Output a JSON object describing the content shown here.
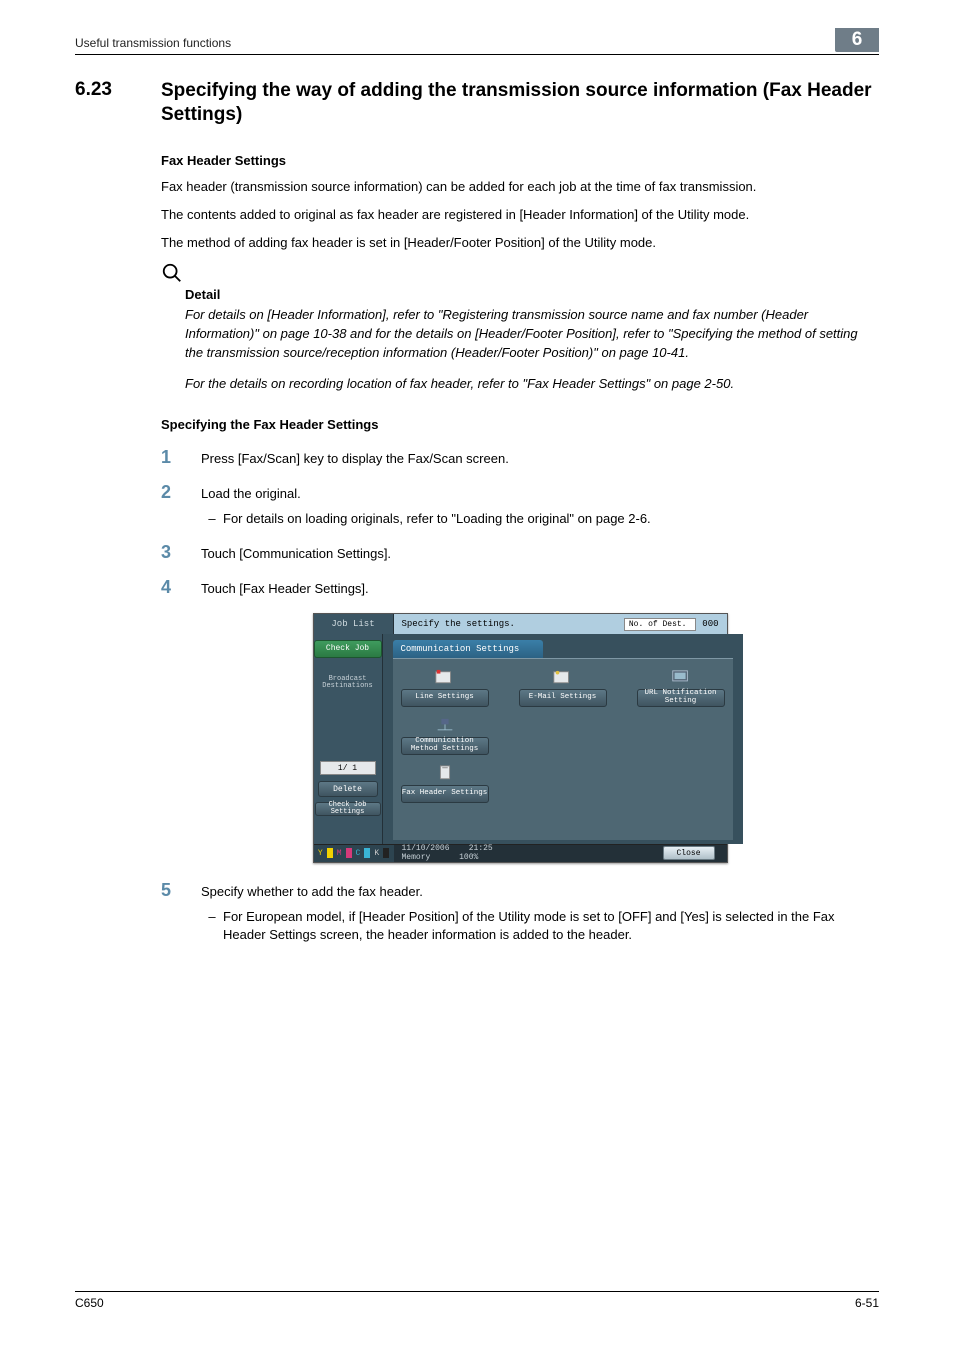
{
  "header": {
    "breadcrumb": "Useful transmission functions",
    "chapter_badge": "6"
  },
  "section": {
    "number": "6.23",
    "title": "Specifying the way of adding the transmission source information (Fax Header Settings)"
  },
  "sub1": {
    "heading": "Fax Header Settings",
    "p1": "Fax header (transmission source information) can be added for each job at the time of fax transmission.",
    "p2": "The contents added to original as fax header are registered in [Header Information] of the Utility mode.",
    "p3": "The method of adding fax header is set in [Header/Footer Position] of the Utility mode."
  },
  "detail": {
    "label": "Detail",
    "p1": "For details on [Header Information], refer to \"Registering transmission source name and fax number (Header Information)\" on page 10-38 and for the details on [Header/Footer Position], refer to \"Specifying the method of setting the transmission source/reception information (Header/Footer Position)\" on page 10-41.",
    "p2": "For the details on recording location of fax header, refer to \"Fax Header Settings\" on page 2-50."
  },
  "sub2_heading": "Specifying the Fax Header Settings",
  "steps": {
    "s1": {
      "n": "1",
      "t": "Press [Fax/Scan] key to display the Fax/Scan screen."
    },
    "s2": {
      "n": "2",
      "t": "Load the original.",
      "b1": "For details on loading originals, refer to \"Loading the original\" on page 2-6."
    },
    "s3": {
      "n": "3",
      "t": "Touch [Communication Settings]."
    },
    "s4": {
      "n": "4",
      "t": "Touch [Fax Header Settings]."
    },
    "s5": {
      "n": "5",
      "t": "Specify whether to add the fax header.",
      "b1": "For European model, if [Header Position] of the Utility mode is set to [OFF] and [Yes] is selected in the Fax Header Settings screen, the header information is added to the header."
    }
  },
  "console": {
    "joblist": "Job List",
    "titlebar": "Specify the settings.",
    "dest_label": "No. of Dest.",
    "dest_count": "000",
    "check_job": "Check Job",
    "broadcast": "Broadcast Destinations",
    "pager": "1/  1",
    "delete": "Delete",
    "check_set": "Check Job Settings",
    "tab": "Communication Settings",
    "btn_line": "Line Settings",
    "btn_email": "E-Mail Settings",
    "btn_url": "URL Notification Setting",
    "btn_comm": "Communication Method Settings",
    "btn_fax": "Fax Header Settings",
    "date": "11/10/2006",
    "time": "21:25",
    "mem_l": "Memory",
    "mem_v": "100%",
    "close": "Close"
  },
  "footer": {
    "left": "C650",
    "right": "6-51"
  }
}
